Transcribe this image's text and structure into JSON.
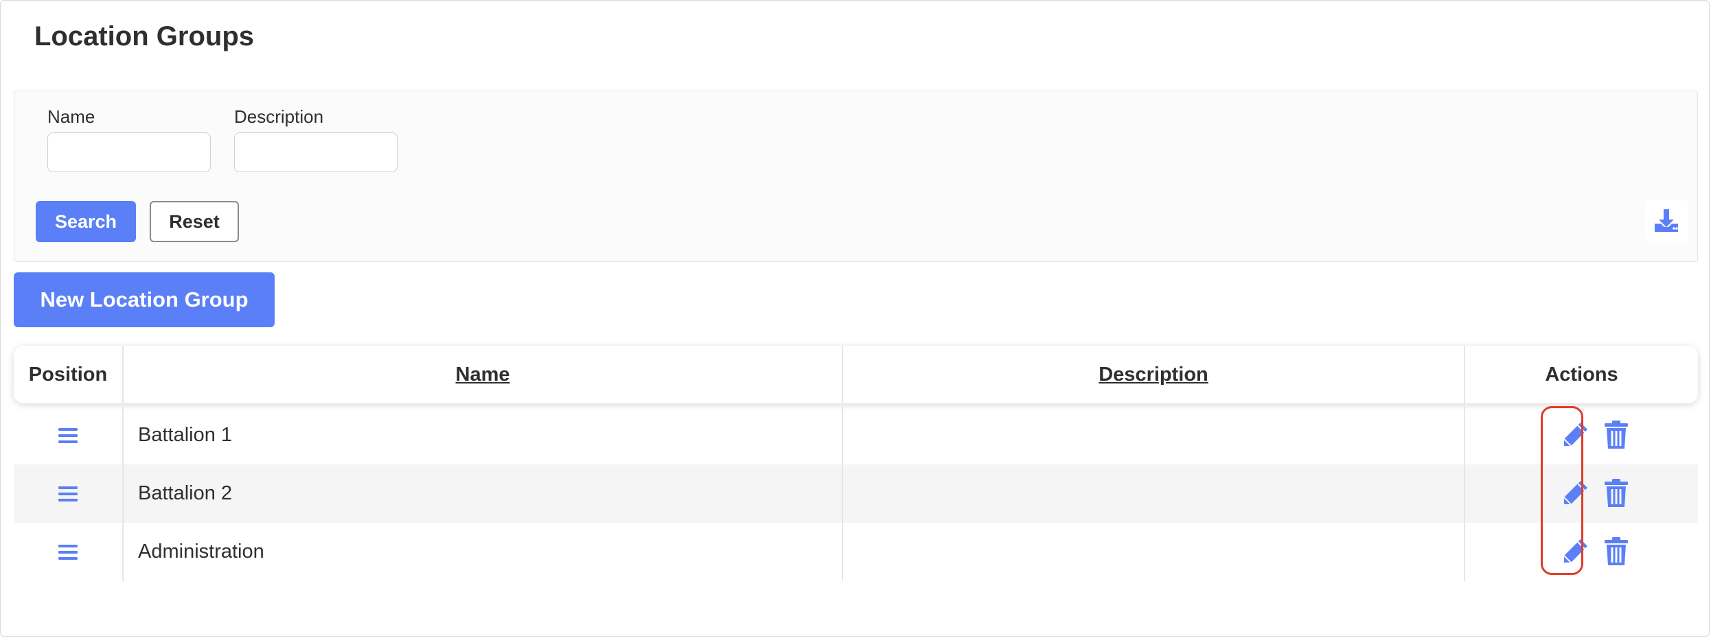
{
  "page": {
    "title": "Location Groups"
  },
  "filters": {
    "name_label": "Name",
    "name_value": "",
    "description_label": "Description",
    "description_value": "",
    "search_label": "Search",
    "reset_label": "Reset",
    "download_icon": "download-icon"
  },
  "actions": {
    "new_label": "New Location Group"
  },
  "table": {
    "columns": {
      "position": "Position",
      "name": "Name",
      "description": "Description",
      "actions": "Actions"
    },
    "rows": [
      {
        "name": "Battalion 1",
        "description": ""
      },
      {
        "name": "Battalion 2",
        "description": ""
      },
      {
        "name": "Administration",
        "description": ""
      }
    ]
  },
  "colors": {
    "accent": "#5b7ff7",
    "highlight": "#e03b2a",
    "text": "#2f2f2f",
    "row_alt": "#f5f5f5"
  },
  "icons": [
    "drag-handle-icon",
    "edit-pencil-icon",
    "trash-icon",
    "download-icon"
  ]
}
